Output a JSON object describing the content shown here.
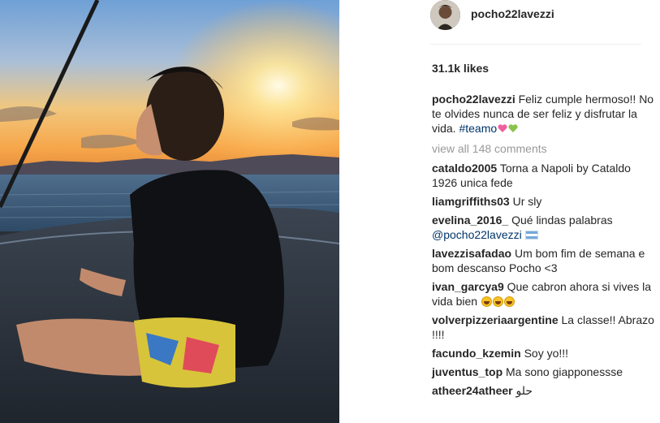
{
  "post": {
    "username": "pocho22lavezzi",
    "likes": "31.1k likes",
    "caption": {
      "user": "pocho22lavezzi",
      "text": "Feliz cumple hermoso!! No te olvides nunca de ser feliz y disfrutar la vida.",
      "hashtag": "#teamo",
      "emojis": [
        "pink-heart-icon",
        "green-heart-icon"
      ]
    },
    "view_all": "view all 148 comments",
    "comments": [
      {
        "user": "cataldo2005",
        "text": "Torna a Napoli by Cataldo 1926 unica fede"
      },
      {
        "user": "liamgriffiths03",
        "text": "Ur sly"
      },
      {
        "user": "evelina_2016_",
        "text": "Qué lindas palabras",
        "mention": "@pocho22lavezzi",
        "emoji": "argentina-flag-icon"
      },
      {
        "user": "lavezzisafadao",
        "text": "Um bom fim de semana e bom descanso Pocho <3"
      },
      {
        "user": "ivan_garcya9",
        "text": "Que cabron ahora si vives la vida bien",
        "emoji": "laughing-face-icon x3"
      },
      {
        "user": "volverpizzeriaargentine",
        "text": "La classe!! Abrazo !!!!"
      },
      {
        "user": "facundo_kzemin",
        "text": "Soy yo!!!"
      },
      {
        "user": "juventus_top",
        "text": "Ma sono giapponessse"
      },
      {
        "user": "atheer24atheer",
        "text": "حلو"
      }
    ]
  },
  "colors": {
    "text": "#262626",
    "link": "#003569",
    "muted": "#999999",
    "divider": "#efefef",
    "heart_pink": "#f0609e",
    "heart_green": "#8bc34a"
  }
}
